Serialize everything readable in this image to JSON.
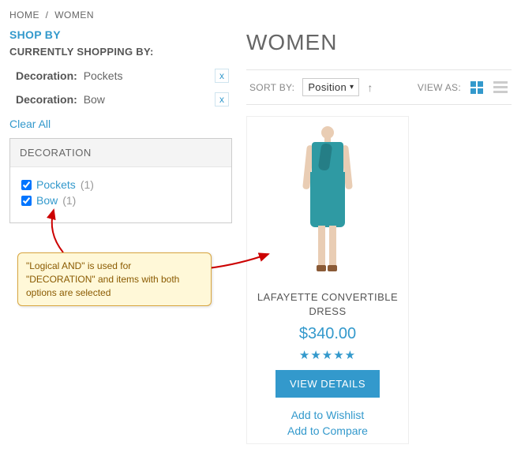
{
  "breadcrumb": {
    "home": "HOME",
    "sep": "/",
    "women": "WOMEN"
  },
  "shopby": {
    "title": "SHOP BY",
    "currently": "CURRENTLY SHOPPING BY:",
    "filters": [
      {
        "label": "Decoration:",
        "value": "Pockets",
        "remove": "x"
      },
      {
        "label": "Decoration:",
        "value": "Bow",
        "remove": "x"
      }
    ],
    "clear": "Clear All"
  },
  "facet": {
    "title": "DECORATION",
    "options": [
      {
        "label": "Pockets",
        "count": "(1)",
        "checked": true
      },
      {
        "label": "Bow",
        "count": "(1)",
        "checked": true
      }
    ]
  },
  "page": {
    "title": "WOMEN"
  },
  "toolbar": {
    "sortby": "SORT BY:",
    "sortval": "Position",
    "viewas": "VIEW AS:"
  },
  "product": {
    "name": "LAFAYETTE CONVERTIBLE DRESS",
    "price": "$340.00",
    "stars": "★★★★★",
    "details": "VIEW DETAILS",
    "wishlist": "Add to Wishlist",
    "compare": "Add to Compare"
  },
  "callout": {
    "text": "\"Logical AND\" is used for \"DECORATION\" and items with both options are selected"
  }
}
